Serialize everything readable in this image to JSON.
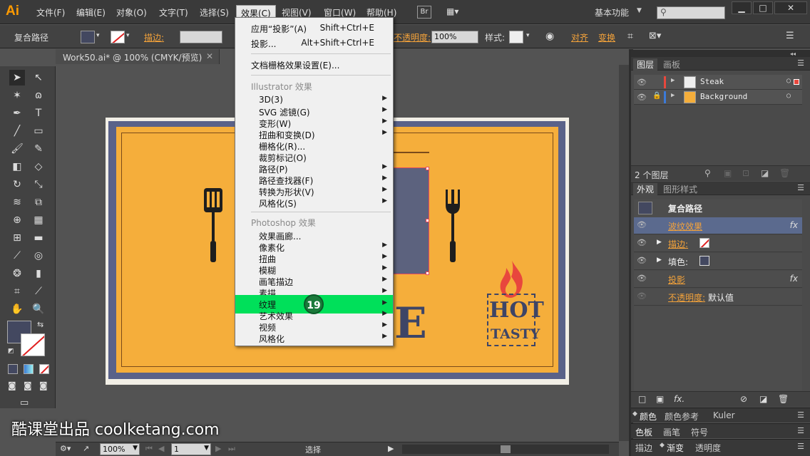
{
  "app": {
    "logo": "Ai"
  },
  "menubar": {
    "items": [
      "文件(F)",
      "编辑(E)",
      "对象(O)",
      "文字(T)",
      "选择(S)",
      "效果(C)",
      "视图(V)",
      "窗口(W)",
      "帮助(H)"
    ],
    "br_label": "Br",
    "workspace": "基本功能"
  },
  "controlbar": {
    "selection_type": "复合路径",
    "stroke_label": "描边:",
    "opacity_label": "不透明度:",
    "opacity_value": "100%",
    "style_label": "样式:",
    "align_label": "对齐",
    "transform_label": "变换"
  },
  "document": {
    "tab_title": "Work50.ai* @ 100% (CMYK/预览)"
  },
  "effect_menu": {
    "apply_last": {
      "label": "应用“投影”(A)",
      "shortcut": "Shift+Ctrl+E"
    },
    "last": {
      "label": "投影...",
      "shortcut": "Alt+Shift+Ctrl+E"
    },
    "raster_settings": "文档栅格效果设置(E)...",
    "illustrator_header": "Illustrator 效果",
    "illustrator_items": [
      "3D(3)",
      "SVG 滤镜(G)",
      "变形(W)",
      "扭曲和变换(D)",
      "栅格化(R)...",
      "裁剪标记(O)",
      "路径(P)",
      "路径查找器(F)",
      "转换为形状(V)",
      "风格化(S)"
    ],
    "photoshop_header": "Photoshop 效果",
    "photoshop_items": [
      "效果画廊...",
      "像素化",
      "扭曲",
      "模糊",
      "画笔描边",
      "素描",
      "纹理",
      "艺术效果",
      "视频",
      "风格化"
    ],
    "highlighted": "纹理",
    "step_badge": "19"
  },
  "artwork": {
    "hot": "HOT",
    "tasty": "TASTY",
    "letter_e": "E"
  },
  "layers_panel": {
    "tabs": [
      "图层",
      "画板"
    ],
    "layers": [
      {
        "name": "Steak",
        "color": "#e8473d"
      },
      {
        "name": "Background",
        "color": "#3c7ad8"
      }
    ],
    "count": "2 个图层"
  },
  "appearance_panel": {
    "tabs": [
      "外观",
      "图形样式"
    ],
    "title": "复合路径",
    "rows": [
      {
        "label": "波纹效果",
        "fx": "fx"
      },
      {
        "label": "描边:"
      },
      {
        "label": "填色:"
      },
      {
        "label": "投影",
        "fx": "fx"
      },
      {
        "label": "不透明度:",
        "value": "默认值"
      }
    ],
    "footer_fx": "fx."
  },
  "bottom_panels": {
    "row1": [
      "颜色",
      "颜色参考",
      "Kuler"
    ],
    "row2": [
      "色板",
      "画笔",
      "符号"
    ],
    "row3": [
      "描边",
      "渐变",
      "透明度"
    ]
  },
  "statusbar": {
    "zoom": "100%",
    "page": "1",
    "tool": "选择"
  },
  "watermark": "酷课堂出品 coolketang.com"
}
